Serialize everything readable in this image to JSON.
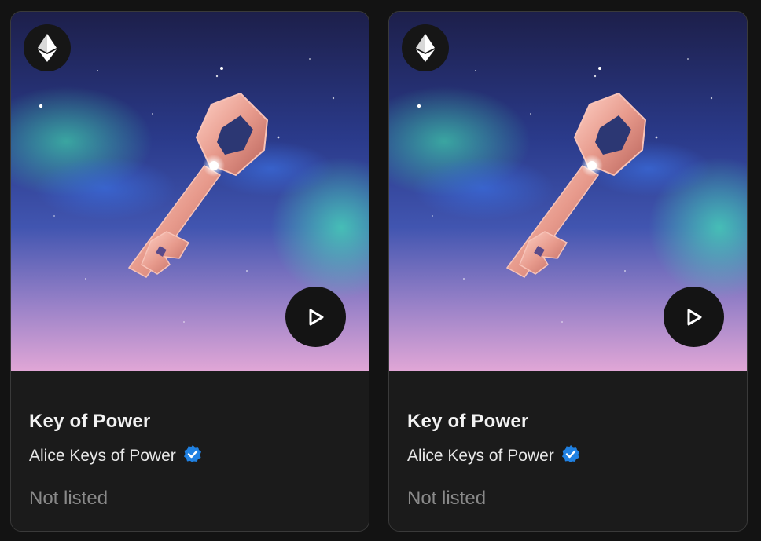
{
  "cards": [
    {
      "title": "Key of Power",
      "creator": "Alice Keys of Power",
      "status": "Not listed",
      "chain_icon": "ethereum-icon",
      "play_icon": "play-icon",
      "verified_icon": "verified-badge-icon"
    },
    {
      "title": "Key of Power",
      "creator": "Alice Keys of Power",
      "status": "Not listed",
      "chain_icon": "ethereum-icon",
      "play_icon": "play-icon",
      "verified_icon": "verified-badge-icon"
    }
  ],
  "colors": {
    "background": "#131313",
    "card": "#1b1b1b",
    "verified": "#2081e2",
    "key": "#e8a89c"
  }
}
